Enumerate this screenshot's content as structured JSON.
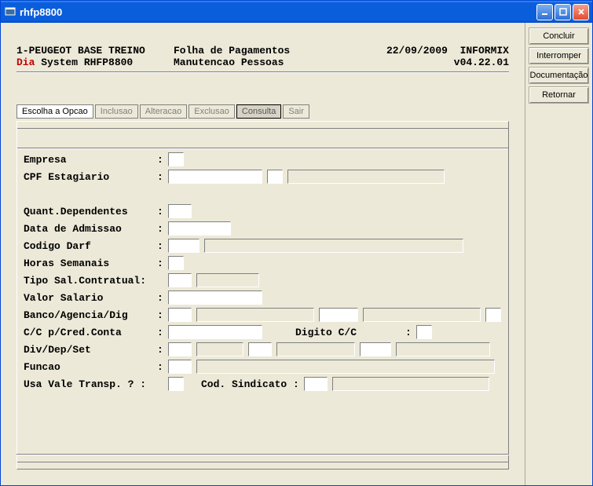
{
  "window": {
    "title": "rhfp8800"
  },
  "side_buttons": [
    "Concluir",
    "Interromper",
    "Documentação",
    "Retornar"
  ],
  "header": {
    "line1_left": "1-PEUGEOT BASE TREINO",
    "line1_mid": "Folha de Pagamentos",
    "line1_date": "22/09/2009",
    "line1_db": "INFORMIX",
    "line2_dia": "Dia",
    "line2_rest": " System  RHFP8800",
    "line2_mid": "Manutencao Pessoas",
    "line2_ver": "v04.22.01"
  },
  "tabs": {
    "escolha": "Escolha a Opcao",
    "inclusao": "Inclusao",
    "alteracao": "Alteracao",
    "exclusao": "Exclusao",
    "consulta": "Consulta",
    "sair": "Sair"
  },
  "labels": {
    "empresa": "Empresa",
    "cpf": "CPF Estagiario",
    "quant_dep": "Quant.Dependentes",
    "data_adm": "Data de Admissao",
    "cod_darf": "Codigo Darf",
    "horas_sem": "Horas Semanais",
    "tipo_sal": "Tipo Sal.Contratual:",
    "valor_sal": "Valor Salario",
    "banco": "Banco/Agencia/Dig",
    "cc_cred": "C/C p/Cred.Conta",
    "digito_cc": "Digito C/C",
    "div_dep": "Div/Dep/Set",
    "funcao": "Funcao",
    "vale": "Usa Vale Transp. ? :",
    "cod_sind": "Cod. Sindicato :"
  }
}
